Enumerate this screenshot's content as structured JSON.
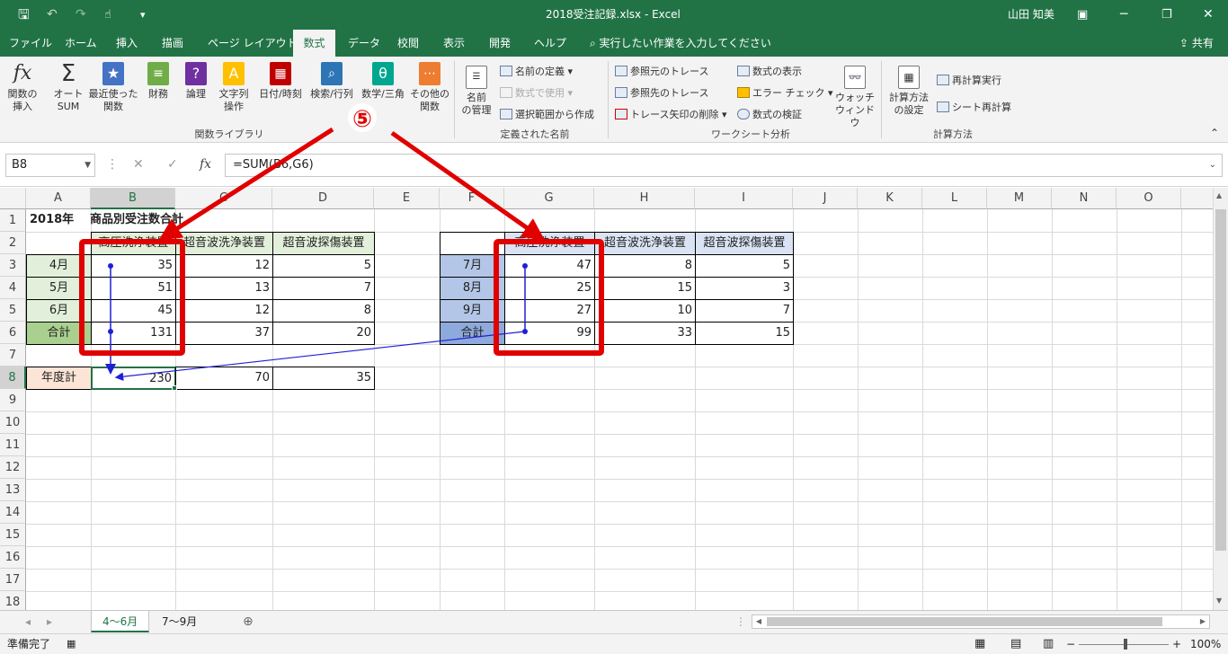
{
  "title": {
    "filename": "2018受注記録.xlsx - Excel",
    "user": "山田 知美",
    "share": "共有"
  },
  "tabs": [
    "ファイル",
    "ホーム",
    "挿入",
    "描画",
    "ページ レイアウト",
    "数式",
    "データ",
    "校閲",
    "表示",
    "開発",
    "ヘルプ"
  ],
  "tell_me": "実行したい作業を入力してください",
  "ribbon": {
    "insert_func": [
      "関数の",
      "挿入"
    ],
    "autosum": [
      "オート",
      "SUM"
    ],
    "recent": [
      "最近使った",
      "関数"
    ],
    "finance": "財務",
    "logical": "論理",
    "text": [
      "文字列",
      "操作"
    ],
    "datetime": "日付/時刻",
    "lookup": "検索/行列",
    "math": "数学/三角",
    "other": [
      "その他の",
      "関数"
    ],
    "group_library": "関数ライブラリ",
    "name_mgr": [
      "名前",
      "の管理"
    ],
    "define_name": "名前の定義",
    "use_in_formula": "数式で使用",
    "create_from_sel": "選択範囲から作成",
    "group_names": "定義された名前",
    "trace_prec": "参照元のトレース",
    "trace_dep": "参照先のトレース",
    "remove_arrows": "トレース矢印の削除",
    "show_formulas": "数式の表示",
    "error_check": "エラー チェック",
    "evaluate": "数式の検証",
    "watch": [
      "ウォッチ",
      "ウィンドウ"
    ],
    "group_audit": "ワークシート分析",
    "calc_opts": [
      "計算方法",
      "の設定"
    ],
    "calc_now": "再計算実行",
    "calc_sheet": "シート再計算",
    "group_calc": "計算方法"
  },
  "formula_bar": {
    "name_box": "B8",
    "formula": "=SUM(B6,G6)",
    "fx": "fx"
  },
  "columns": [
    "A",
    "B",
    "C",
    "D",
    "E",
    "F",
    "G",
    "H",
    "I",
    "J",
    "K",
    "L",
    "M",
    "N",
    "O"
  ],
  "rows": [
    "1",
    "2",
    "3",
    "4",
    "5",
    "6",
    "7",
    "8",
    "9",
    "10",
    "11",
    "12",
    "13",
    "14",
    "15",
    "16",
    "17",
    "18"
  ],
  "sheet": {
    "a1": "2018年",
    "b1": "商品別受注数合計",
    "headers": [
      "高圧洗浄装置",
      "超音波洗浄装置",
      "超音波探傷装置"
    ],
    "t1_months": [
      "4月",
      "5月",
      "6月",
      "合計"
    ],
    "t1_values": [
      [
        "35",
        "12",
        "5"
      ],
      [
        "51",
        "13",
        "7"
      ],
      [
        "45",
        "12",
        "8"
      ],
      [
        "131",
        "37",
        "20"
      ]
    ],
    "t2_months": [
      "7月",
      "8月",
      "9月",
      "合計"
    ],
    "t2_values": [
      [
        "47",
        "8",
        "5"
      ],
      [
        "25",
        "15",
        "3"
      ],
      [
        "27",
        "10",
        "7"
      ],
      [
        "99",
        "33",
        "15"
      ]
    ],
    "year_label": "年度計",
    "year_values": [
      "230",
      "70",
      "35"
    ]
  },
  "callout": "⑤",
  "sheet_tabs": [
    "4～6月",
    "7～9月"
  ],
  "status": {
    "ready": "準備完了",
    "zoom": "100%"
  },
  "colors": {
    "excel_green": "#217346",
    "callout_red": "#e00000",
    "arrow_blue": "#1f1fd6",
    "q1_fill": "#e2efda",
    "q1_total": "#a9d08e",
    "q2_fill": "#b4c6e7",
    "q2_total": "#8ea9db",
    "year_fill": "#fce4d6"
  }
}
